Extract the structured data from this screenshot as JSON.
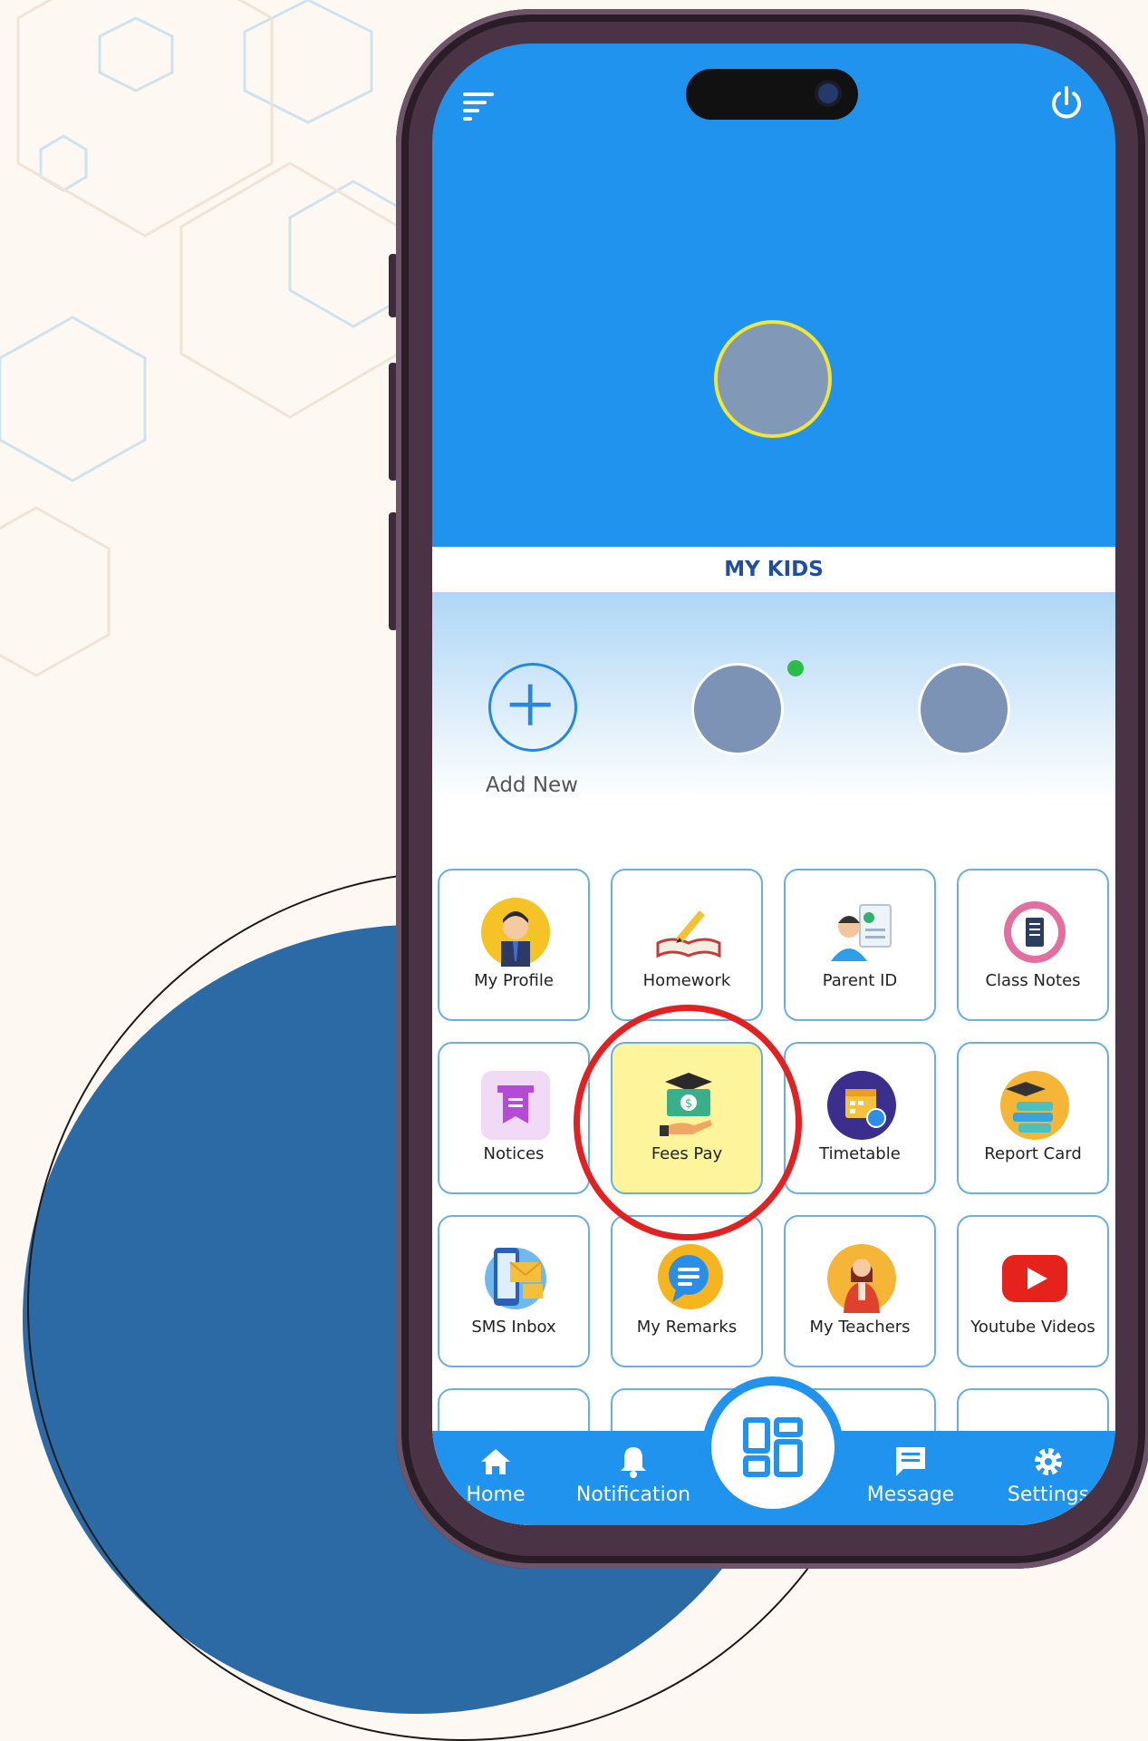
{
  "header": {
    "menu_icon": "menu-icon",
    "power_icon": "power-icon"
  },
  "kids": {
    "title": "MY KIDS",
    "add_label": "Add New"
  },
  "tiles": [
    {
      "label": "My Profile",
      "icon": "student-icon"
    },
    {
      "label": "Homework",
      "icon": "book-pencil-icon"
    },
    {
      "label": "Parent ID",
      "icon": "id-card-icon"
    },
    {
      "label": "Class Notes",
      "icon": "clipboard-icon"
    },
    {
      "label": "Notices",
      "icon": "notice-icon"
    },
    {
      "label": "Fees Pay",
      "icon": "money-icon",
      "highlighted": true
    },
    {
      "label": "Timetable",
      "icon": "calendar-icon"
    },
    {
      "label": "Report Card",
      "icon": "graduation-books-icon"
    },
    {
      "label": "SMS Inbox",
      "icon": "sms-phone-icon"
    },
    {
      "label": "My Remarks",
      "icon": "chat-bubble-icon"
    },
    {
      "label": "My Teachers",
      "icon": "teacher-icon"
    },
    {
      "label": "Youtube Videos",
      "icon": "youtube-icon"
    }
  ],
  "nav": {
    "home": "Home",
    "notification": "Notification",
    "message": "Message",
    "settings": "Settings"
  },
  "colors": {
    "primary": "#1f93ee",
    "highlight_tile": "#fdf49b",
    "annotation_ring": "#e02222",
    "title_text": "#1e4fa4"
  }
}
